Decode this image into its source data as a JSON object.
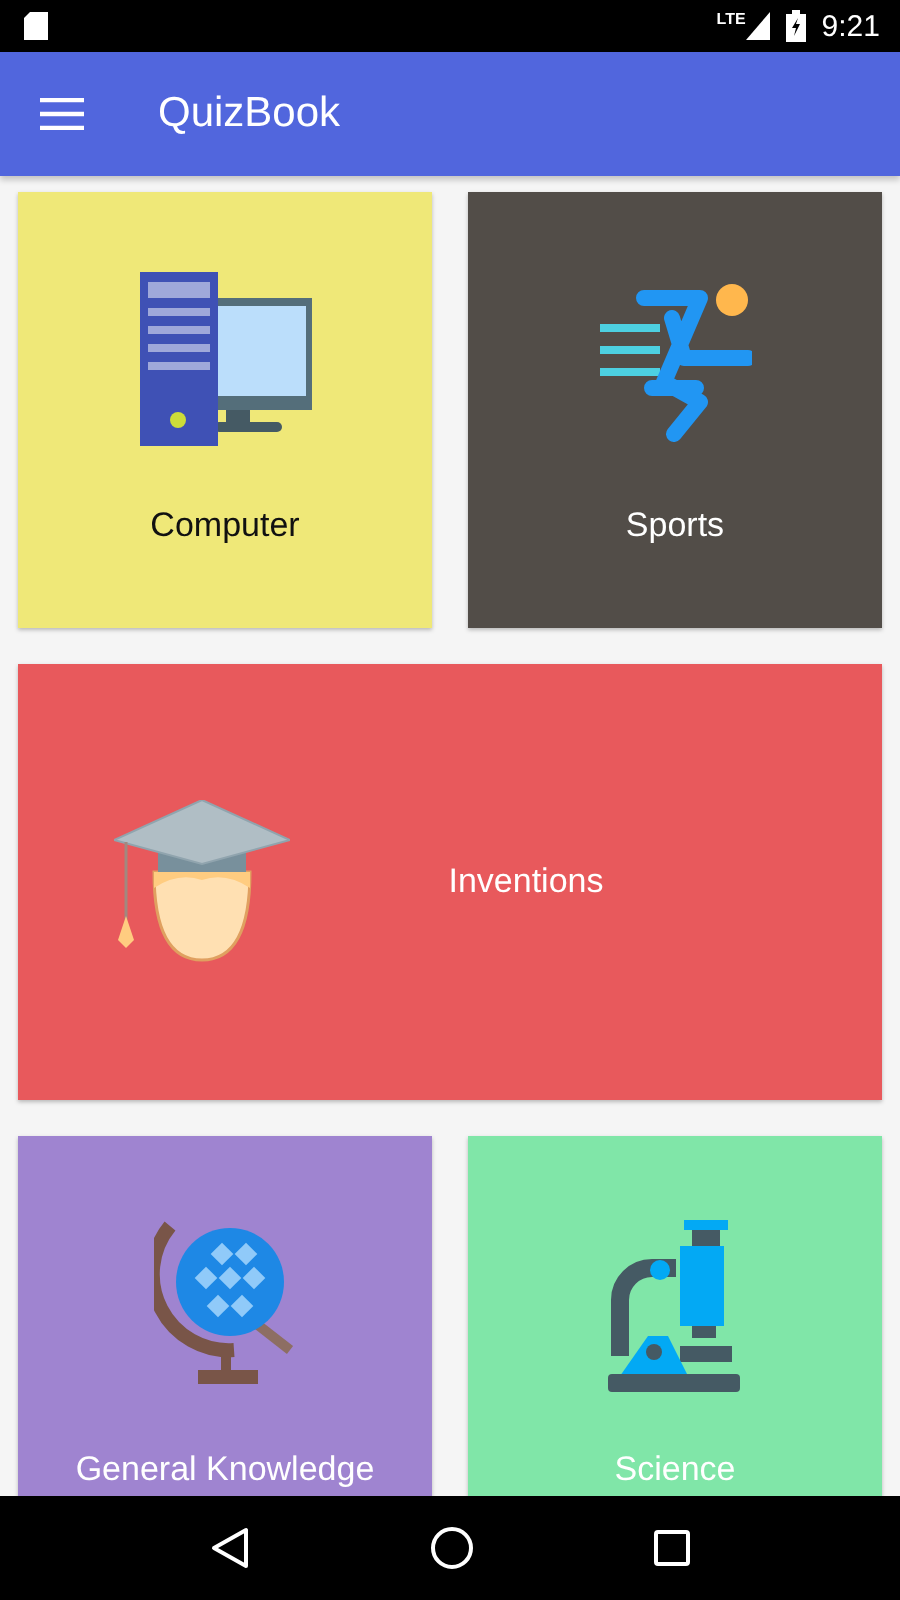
{
  "status_bar": {
    "network": "LTE",
    "time": "9:21"
  },
  "app_bar": {
    "title": "QuizBook"
  },
  "categories": [
    {
      "label": "Computer",
      "kind": "computer",
      "color": "#efe878",
      "wide": false
    },
    {
      "label": "Sports",
      "kind": "sports",
      "color": "#524d48",
      "wide": false
    },
    {
      "label": "Inventions",
      "kind": "inventions",
      "color": "#e8595c",
      "wide": true
    },
    {
      "label": "General Knowledge",
      "kind": "globe",
      "color": "#9f84d0",
      "wide": false
    },
    {
      "label": "Science",
      "kind": "science",
      "color": "#80e6a8",
      "wide": false
    }
  ]
}
